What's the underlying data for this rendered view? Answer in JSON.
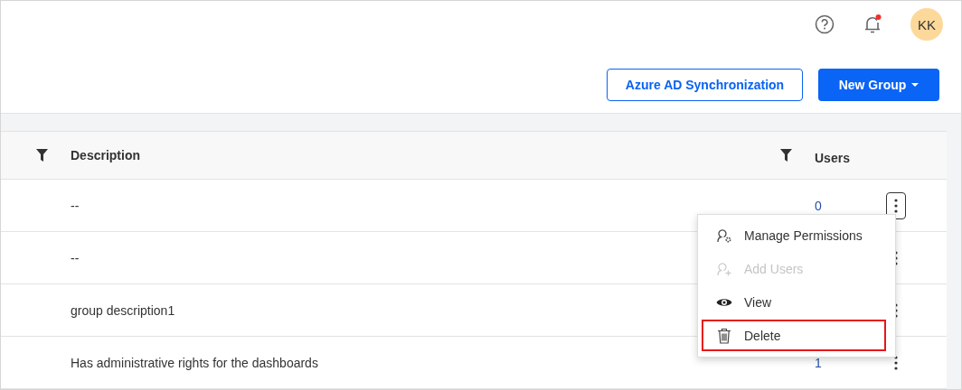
{
  "header": {
    "notifications_unread": true,
    "avatar_initials": "KK"
  },
  "actions": {
    "secondary_button": "Azure AD Synchronization",
    "primary_button": "New Group"
  },
  "table": {
    "columns": [
      "Description",
      "Users"
    ],
    "rows": [
      {
        "description": "--",
        "users": "0",
        "menu_open": true
      },
      {
        "description": "--",
        "menu_open": false
      },
      {
        "description": "group description1",
        "menu_open": false
      },
      {
        "description": "Has administrative rights for the dashboards",
        "users": "1",
        "menu_open": false
      }
    ]
  },
  "context_menu": {
    "items": [
      {
        "label": "Manage Permissions",
        "disabled": false,
        "highlighted": false
      },
      {
        "label": "Add Users",
        "disabled": true,
        "highlighted": false
      },
      {
        "label": "View",
        "disabled": false,
        "highlighted": false
      },
      {
        "label": "Delete",
        "disabled": false,
        "highlighted": true
      }
    ]
  }
}
